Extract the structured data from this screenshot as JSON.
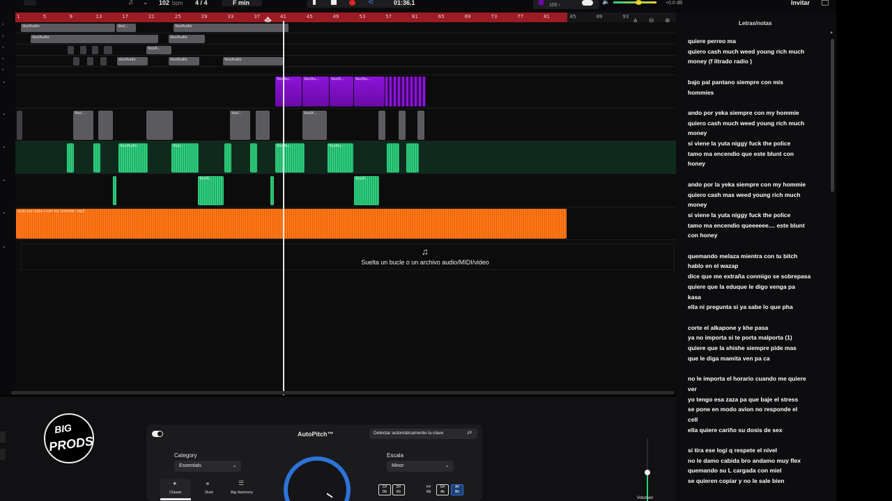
{
  "toolbar": {
    "tempo_value": "102",
    "tempo_unit": "bpm",
    "time_signature": "4 / 4",
    "key": "F min",
    "time_display": "01:36.1",
    "vol_readout": "100 ›",
    "db_readout": "+0.0 dB",
    "invite_label": "Invitar"
  },
  "ruler": {
    "marks": [
      "1",
      "5",
      "9",
      "13",
      "17",
      "21",
      "25",
      "29",
      "33",
      "37",
      "41",
      "45",
      "49",
      "53",
      "57",
      "61",
      "65",
      "69",
      "73",
      "77",
      "81",
      "85",
      "89",
      "93"
    ]
  },
  "tracks": {
    "clip_labels": {
      "voz_audio": "Voz/Audio",
      "voz_short": "Voz/...",
      "voz_a": "Voz/A...",
      "voz_au": "Voz/Au..."
    },
    "orange_clip": "ando por yeka s con my hommie .mp3",
    "drop_zone_text": "Suelta un bucle o un archivo audio/MIDI/video"
  },
  "lyrics_panel": {
    "title": "Letras/notas",
    "stanzas": [
      [
        "quiere perreo ma",
        "quiero cash much weed  young rich  much",
        "money (f iltrado radio )"
      ],
      [
        "bajo pal pantano siempre con mis",
        "hommies"
      ],
      [
        "ando por yeka siempre con my hommie",
        "quiero cash much weed  young rich  much",
        "money",
        "si viene la yuta niggy fuck the police",
        " tamo ma encendio que este blunt con",
        "honey"
      ],
      [
        " ando por la  yeka siempre con my hommie",
        "quiero cash mas weed  young rich  much",
        "money",
        "si viene la yuta niggy fuck the police",
        " tamo ma encendio queeeeee.... este blunt",
        "con honey"
      ],
      [
        "quemando melaza mientra con tu bitch",
        "hablo en el wazap",
        "dice que me extraña conmigo se sobrepasa",
        " quiere que la eduque le digo venga pa",
        "kasa",
        "ella ni pregunta si ya sabe lo que pha"
      ],
      [
        " corte el alkapone y khe pasa",
        "ya no importa si te porta malporta (1)",
        "quiere que la shishe siempre pide mas",
        "que  le diga mamita ven  pa ca"
      ],
      [
        "no le importa el horario cuando me quiere",
        "ver",
        "yo tengo esa zaza pa que baje el stress",
        " se pone en  modo avion no responde el",
        "cell",
        "ella quiere cariño su dosis de sex"
      ],
      [
        "si tira ese logi q respete el nivel",
        "no le damo cabida bro andamo muy flex",
        "quemando su L cargada con miel",
        "se quieren copiar y no le sale bien"
      ]
    ]
  },
  "bottom": {
    "logo_line1": "BIG",
    "logo_line2": "PRODS",
    "fx_title": "AutoPitch™",
    "auto_detect_label": "Detectar automáticamente la clave",
    "category_label": "Category",
    "category_value": "Essentials",
    "scale_label": "Escala",
    "scale_value": "Minor",
    "presets": [
      "Classic",
      "Duet",
      "Big Harmony"
    ],
    "keys": [
      {
        "top": "C#",
        "bottom": "Db"
      },
      {
        "top": "D#",
        "bottom": "Eb"
      },
      {
        "top": "F#",
        "bottom": "Gb"
      },
      {
        "top": "G#",
        "bottom": "Ab"
      },
      {
        "top": "A#",
        "bottom": "Bb"
      }
    ],
    "volume_label": "Volumen"
  },
  "colors": {
    "ruler_active": "#9b1c25",
    "purple_track": "#8c14d8",
    "green_track": "#2fd07f",
    "orange_track": "#ff7a1a",
    "knob_accent": "#2d74d8",
    "record": "#e02626"
  }
}
